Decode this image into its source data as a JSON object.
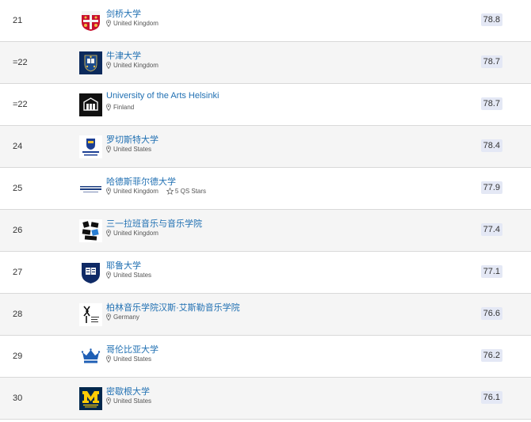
{
  "rows": [
    {
      "rank": "21",
      "name": "剑桥大学",
      "country": "United Kingdom",
      "stars": "",
      "score": "78.8",
      "logo": "cambridge-crest"
    },
    {
      "rank": "=22",
      "name": "牛津大学",
      "country": "United Kingdom",
      "stars": "",
      "score": "78.7",
      "logo": "oxford-crest"
    },
    {
      "rank": "=22",
      "name": "University of the Arts Helsinki",
      "country": "Finland",
      "stars": "",
      "score": "78.7",
      "logo": "uniarts-logo"
    },
    {
      "rank": "24",
      "name": "罗切斯特大学",
      "country": "United States",
      "stars": "",
      "score": "78.4",
      "logo": "rochester-logo"
    },
    {
      "rank": "25",
      "name": "哈德斯菲尔德大学",
      "country": "United Kingdom",
      "stars": "5 QS Stars",
      "score": "77.9",
      "logo": "huddersfield-logo"
    },
    {
      "rank": "26",
      "name": "三一拉班音乐与音乐学院",
      "country": "United Kingdom",
      "stars": "",
      "score": "77.4",
      "logo": "trinity-laban-logo"
    },
    {
      "rank": "27",
      "name": "耶鲁大学",
      "country": "United States",
      "stars": "",
      "score": "77.1",
      "logo": "yale-shield"
    },
    {
      "rank": "28",
      "name": "柏林音乐学院汉斯·艾斯勒音乐学院",
      "country": "Germany",
      "stars": "",
      "score": "76.6",
      "logo": "hanns-eisler-logo"
    },
    {
      "rank": "29",
      "name": "哥伦比亚大学",
      "country": "United States",
      "stars": "",
      "score": "76.2",
      "logo": "columbia-crown"
    },
    {
      "rank": "30",
      "name": "密歇根大学",
      "country": "United States",
      "stars": "",
      "score": "76.1",
      "logo": "michigan-block-m"
    }
  ]
}
